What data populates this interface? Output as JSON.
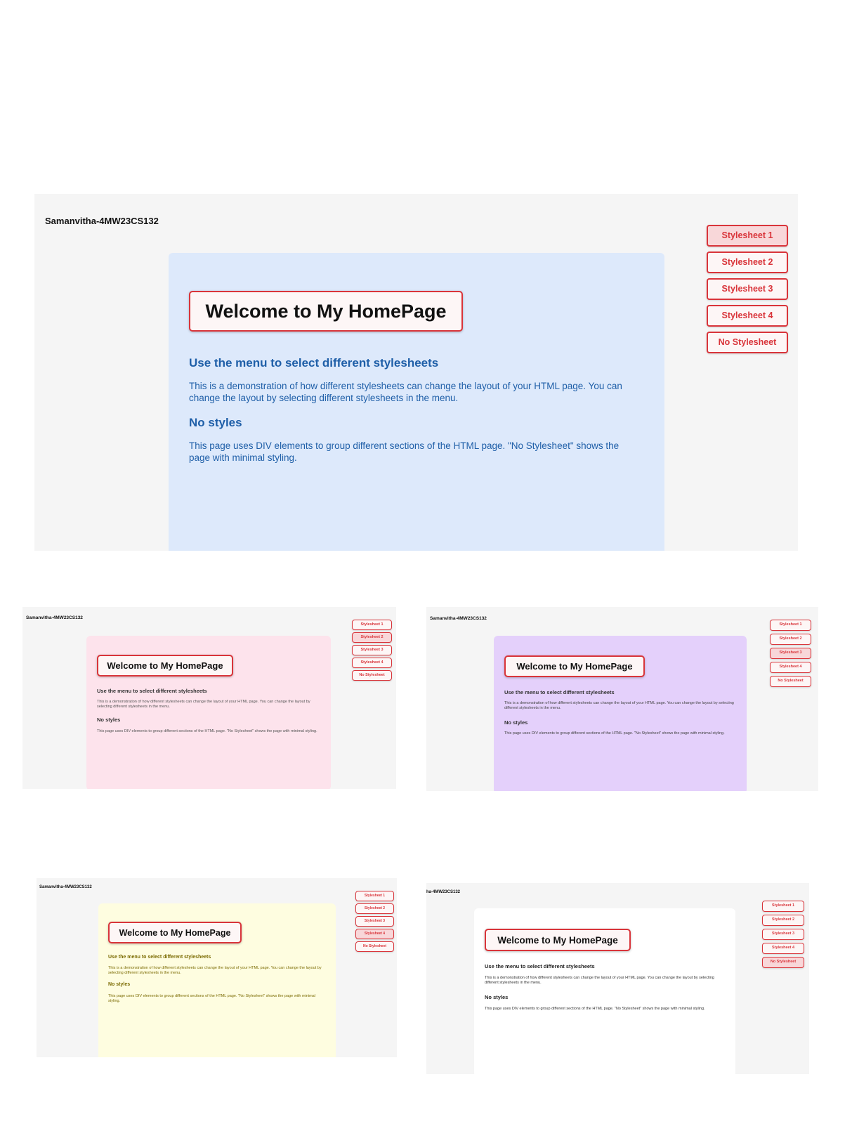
{
  "author": "Samanvitha-4MW23CS132",
  "author_cropped": "ha-4MW23CS132",
  "heading": "Welcome to My HomePage",
  "subheading1": "Use the menu to select different stylesheets",
  "paragraph1": "This is a demonstration of how different stylesheets can change the layout of your HTML page. You can change the layout by selecting different stylesheets in the menu.",
  "subheading2": "No styles",
  "paragraph2": "This page uses DIV elements to group different sections of the HTML page. \"No Stylesheet\" shows the page with minimal styling.",
  "menu": [
    "Stylesheet 1",
    "Stylesheet 2",
    "Stylesheet 3",
    "Stylesheet 4",
    "No Stylesheet"
  ],
  "colors": {
    "accent": "#d9343a",
    "stylesheet1_bg": "#dde9fb",
    "stylesheet1_text": "#1f5fa8",
    "stylesheet2_bg": "#fde3ec",
    "stylesheet3_bg": "#e4d0fb",
    "stylesheet4_bg": "#fefde0",
    "stylesheet4_text": "#7a6a00",
    "no_stylesheet_bg": "#ffffff"
  },
  "active_buttons": {
    "screenshot1": "Stylesheet 1",
    "screenshot2": "Stylesheet 2",
    "screenshot3": "Stylesheet 3",
    "screenshot4": "Stylesheet 4",
    "screenshot5": "No Stylesheet"
  }
}
